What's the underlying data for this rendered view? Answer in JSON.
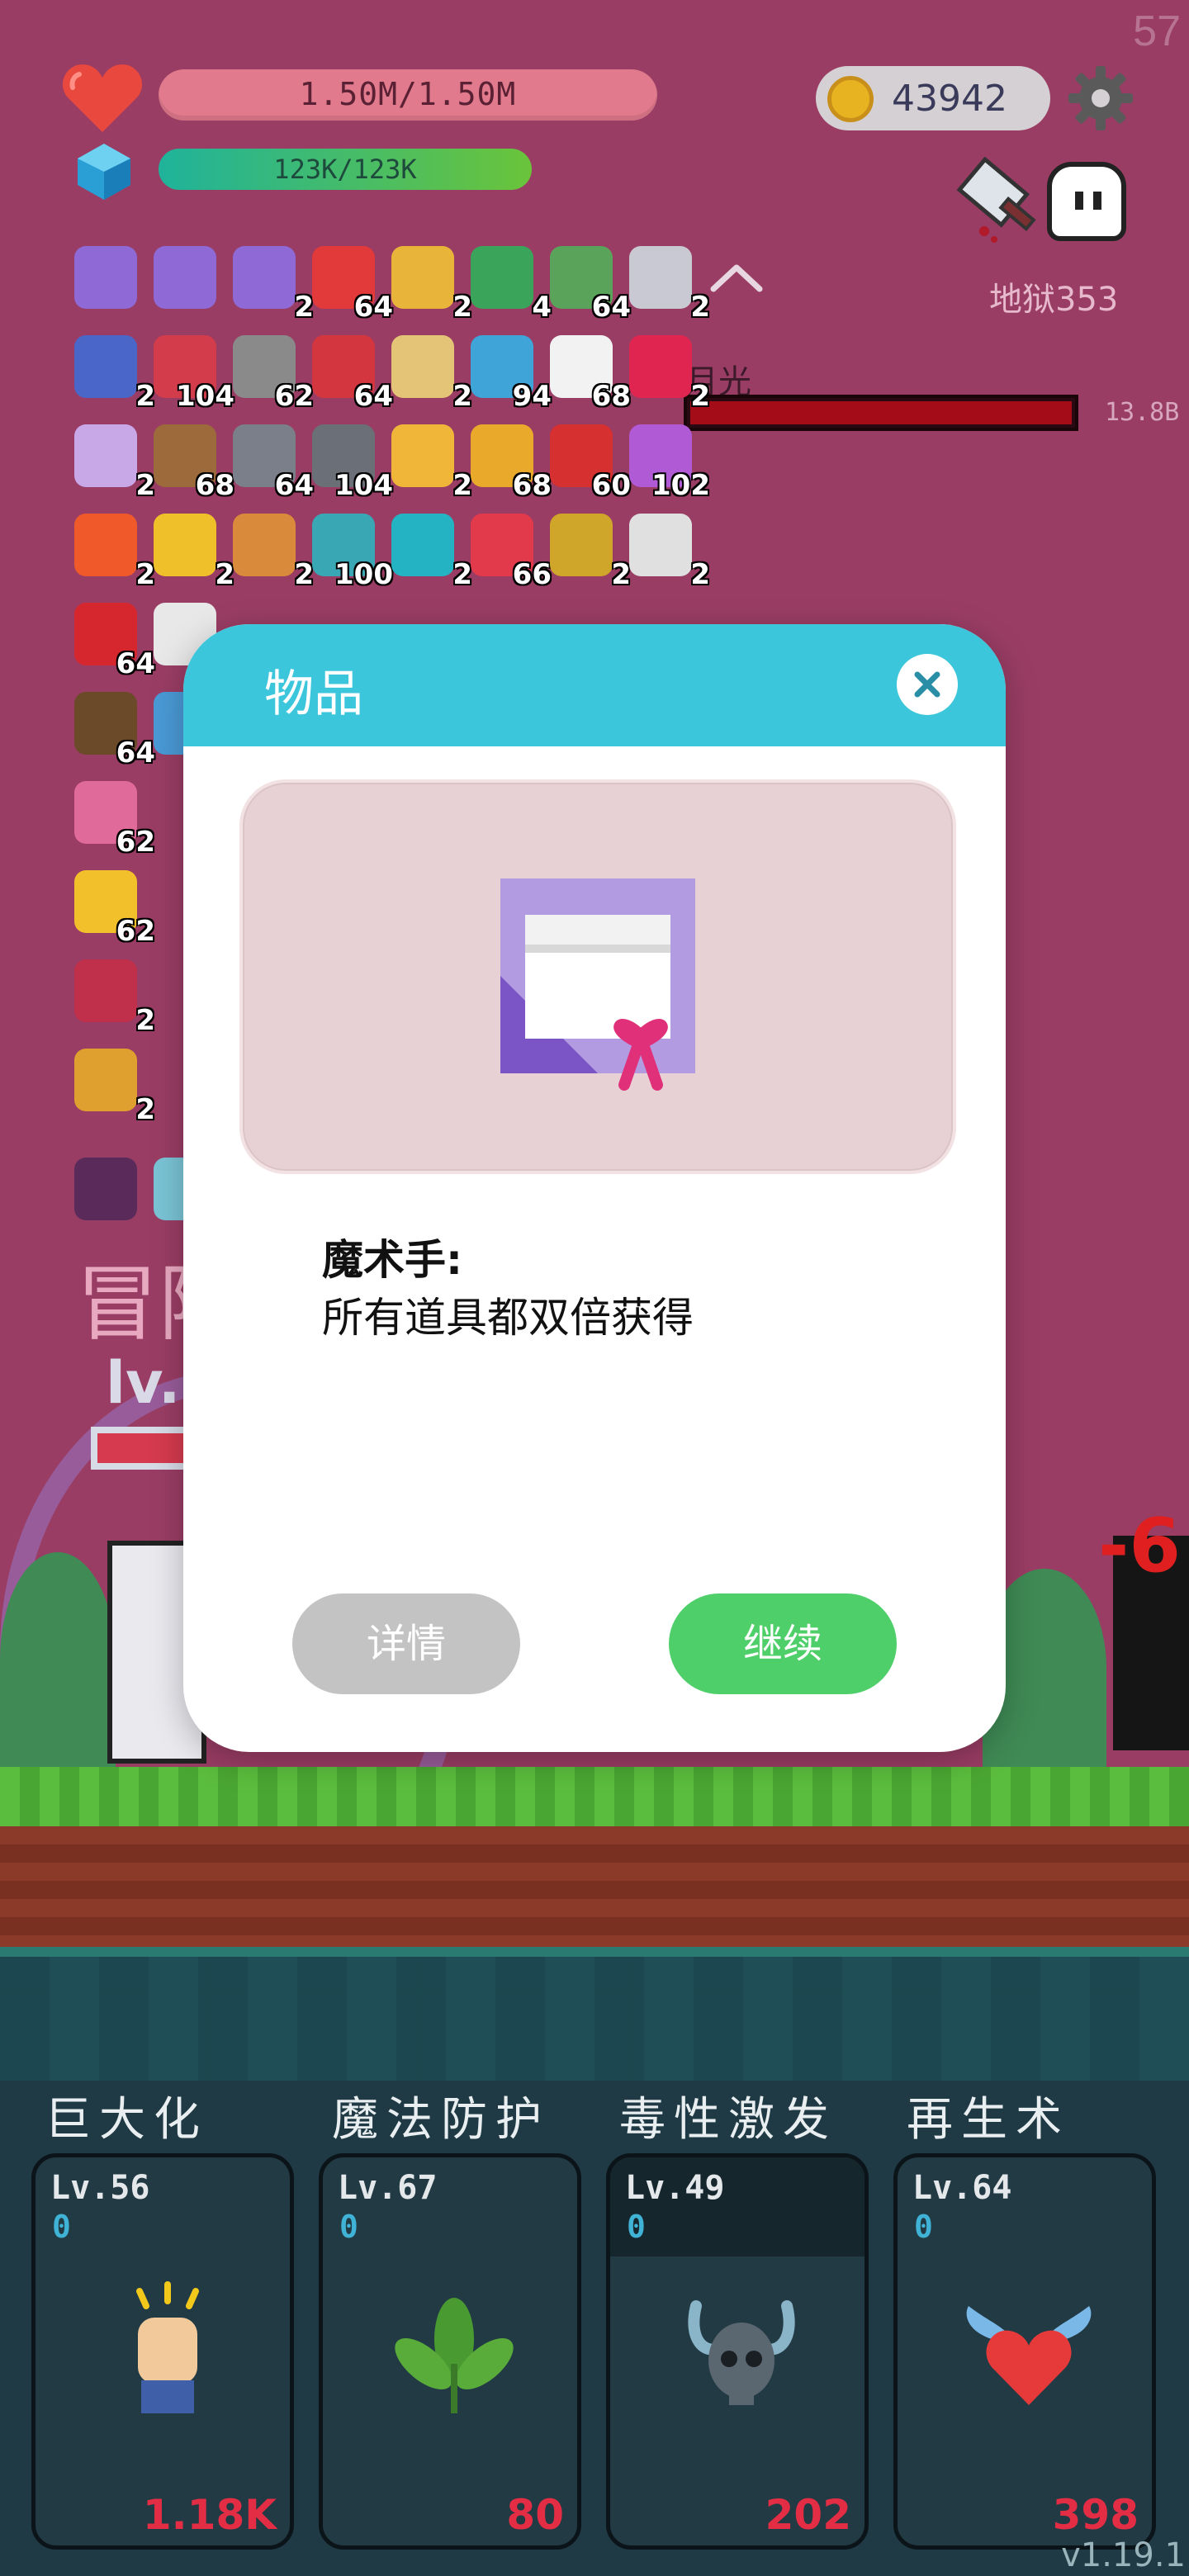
{
  "hud": {
    "fps": "57",
    "hp_text": "1.50M/1.50M",
    "mp_text": "123K/123K",
    "coins": "43942",
    "stage": "地狱353",
    "boss_name": "月光",
    "boss_hp": "13.8B"
  },
  "inventory": [
    {
      "icon": "gift-scroll-icon",
      "count": "",
      "color": "#8f6ad6"
    },
    {
      "icon": "gift-scroll-icon",
      "count": "",
      "color": "#8f6ad6"
    },
    {
      "icon": "gift-scroll-icon",
      "count": "2",
      "color": "#8f6ad6"
    },
    {
      "icon": "strawberry-icon",
      "count": "64",
      "color": "#e23a3a"
    },
    {
      "icon": "beer-mug-icon",
      "count": "2",
      "color": "#e9b43a"
    },
    {
      "icon": "green-card-icon",
      "count": "4",
      "color": "#3aa55a"
    },
    {
      "icon": "money-heart-icon",
      "count": "64",
      "color": "#5aa35a"
    },
    {
      "icon": "question-mark-icon",
      "count": "2",
      "color": "#c9c9d3"
    },
    {
      "icon": "wizard-hat-icon",
      "count": "2",
      "color": "#4a66c9"
    },
    {
      "icon": "big-heart-icon",
      "count": "104",
      "color": "#d33c4a"
    },
    {
      "icon": "tombstone-icon",
      "count": "62",
      "color": "#8a8a8a"
    },
    {
      "icon": "red-sock-icon",
      "count": "64",
      "color": "#d3363f"
    },
    {
      "icon": "scroll-icon",
      "count": "2",
      "color": "#e4c477"
    },
    {
      "icon": "potion-flask-icon",
      "count": "94",
      "color": "#3fa5d9"
    },
    {
      "icon": "daisy-icon",
      "count": "68",
      "color": "#f2f2f2"
    },
    {
      "icon": "ruby-icon",
      "count": "2",
      "color": "#e02650"
    },
    {
      "icon": "unicorn-icon",
      "count": "2",
      "color": "#c9a8e8"
    },
    {
      "icon": "donut-ring-icon",
      "count": "68",
      "color": "#9d6b3b"
    },
    {
      "icon": "axe-icon",
      "count": "64",
      "color": "#7a7f8a"
    },
    {
      "icon": "spiked-ball-icon",
      "count": "104",
      "color": "#6a6f78"
    },
    {
      "icon": "bomb-icon",
      "count": "2",
      "color": "#f0b63a"
    },
    {
      "icon": "gold-coins-icon",
      "count": "68",
      "color": "#e9a92a"
    },
    {
      "icon": "red-card-icon",
      "count": "60",
      "color": "#d63030"
    },
    {
      "icon": "tulip-icon",
      "count": "102",
      "color": "#b05ad6"
    },
    {
      "icon": "flame-icon",
      "count": "2",
      "color": "#f05a2a"
    },
    {
      "icon": "crown-icon",
      "count": "2",
      "color": "#f0c02a"
    },
    {
      "icon": "briefcase-icon",
      "count": "2",
      "color": "#d98a3a"
    },
    {
      "icon": "gray-ring-icon",
      "count": "100",
      "color": "#3aa7b5"
    },
    {
      "icon": "teal-spiral-icon",
      "count": "2",
      "color": "#23b3c2"
    },
    {
      "icon": "watermelon-icon",
      "count": "66",
      "color": "#e23a4a"
    },
    {
      "icon": "durian-icon",
      "count": "2",
      "color": "#cfa52a"
    },
    {
      "icon": "molecule-icon",
      "count": "2",
      "color": "#e0e0e0"
    },
    {
      "icon": "apple-icon",
      "count": "64",
      "color": "#d6262e"
    },
    {
      "icon": "playing-card-icon",
      "count": "",
      "color": "#e8e8e8"
    },
    {
      "icon": "coconut-icon",
      "count": "64",
      "color": "#6b4a2a"
    },
    {
      "icon": "shirt-icon",
      "count": "",
      "color": "#4a9ad6"
    },
    {
      "icon": "pink-bottle-icon",
      "count": "62",
      "color": "#e06a9a"
    },
    {
      "icon": "sunflower-icon",
      "count": "62",
      "color": "#f2c02a"
    },
    {
      "icon": "thermometer-icon",
      "count": "2",
      "color": "#c0304a"
    },
    {
      "icon": "wrench-icon",
      "count": "2",
      "color": "#e0a030"
    },
    {
      "icon": "demon-mask-icon",
      "count": "",
      "color": "#5a2a5a"
    },
    {
      "icon": "ornate-box-icon",
      "count": "",
      "color": "#7ac4d6"
    }
  ],
  "scene": {
    "title_fragment": "冒险",
    "lv_fragment": "lv."
  },
  "skills": [
    {
      "title": "巨大化",
      "level": "Lv.56",
      "value": "0",
      "cost": "1.18K",
      "icon": "fist-icon"
    },
    {
      "title": "魔法防护",
      "level": "Lv.67",
      "value": "0",
      "cost": "80",
      "icon": "leaf-sprout-icon"
    },
    {
      "title": "毒性激发",
      "level": "Lv.49",
      "value": "0",
      "cost": "202",
      "icon": "horned-skull-icon"
    },
    {
      "title": "再生术",
      "level": "Lv.64",
      "value": "0",
      "cost": "398",
      "icon": "winged-heart-icon"
    }
  ],
  "version": "v1.19.1",
  "modal": {
    "title": "物品",
    "item_name": "魔术手:",
    "item_desc": "所有道具都双倍获得",
    "detail_label": "详情",
    "continue_label": "继续",
    "item_icon": "gift-scroll-icon"
  },
  "colors": {
    "background": "#9a3d64",
    "modal_header": "#3cc6dc",
    "continue_button": "#4fcf6a",
    "detail_button": "#c3c3c3",
    "hp_bar": "#e07a8c",
    "boss_bar": "#a40d17"
  }
}
